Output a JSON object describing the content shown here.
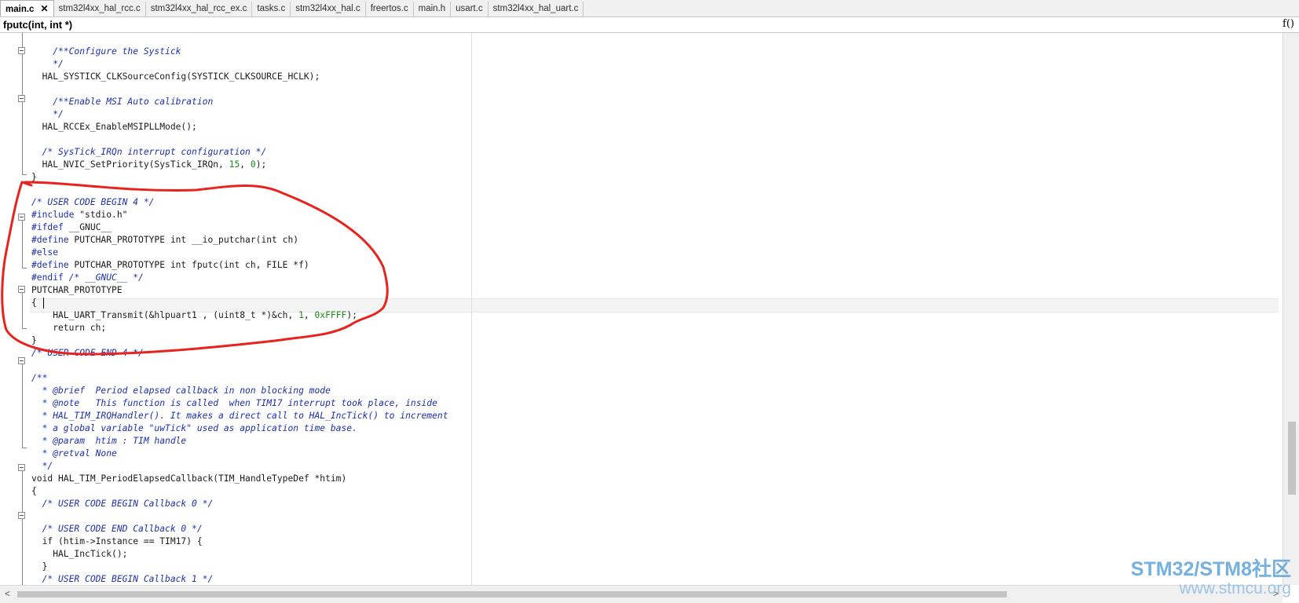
{
  "tabs": [
    {
      "label": "main.c",
      "active": true
    },
    {
      "label": "stm32l4xx_hal_rcc.c"
    },
    {
      "label": "stm32l4xx_hal_rcc_ex.c"
    },
    {
      "label": "tasks.c"
    },
    {
      "label": "stm32l4xx_hal.c"
    },
    {
      "label": "freertos.c"
    },
    {
      "label": "main.h"
    },
    {
      "label": "usart.c"
    },
    {
      "label": "stm32l4xx_hal_uart.c"
    }
  ],
  "tab_close_glyph": "✕",
  "function_bar": {
    "name": "fputc(int, int *)",
    "icon_label": "f()"
  },
  "code_lines": [
    "",
    "    /**Configure the Systick",
    "    */",
    "  HAL_SYSTICK_CLKSourceConfig(SYSTICK_CLKSOURCE_HCLK);",
    "",
    "    /**Enable MSI Auto calibration",
    "    */",
    "  HAL_RCCEx_EnableMSIPLLMode();",
    "",
    "  /* SysTick_IRQn interrupt configuration */",
    "  HAL_NVIC_SetPriority(SysTick_IRQn, 15, 0);",
    "}",
    "",
    "/* USER CODE BEGIN 4 */",
    "#include \"stdio.h\"",
    "#ifdef __GNUC__",
    "#define PUTCHAR_PROTOTYPE int __io_putchar(int ch)",
    "#else",
    "#define PUTCHAR_PROTOTYPE int fputc(int ch, FILE *f)",
    "#endif /* __GNUC__ */",
    "PUTCHAR_PROTOTYPE",
    "{",
    "    HAL_UART_Transmit(&hlpuart1 , (uint8_t *)&ch, 1, 0xFFFF);",
    "    return ch;",
    "}",
    "/* USER CODE END 4 */",
    "",
    "/**",
    "  * @brief  Period elapsed callback in non blocking mode",
    "  * @note   This function is called  when TIM17 interrupt took place, inside",
    "  * HAL_TIM_IRQHandler(). It makes a direct call to HAL_IncTick() to increment",
    "  * a global variable \"uwTick\" used as application time base.",
    "  * @param  htim : TIM handle",
    "  * @retval None",
    "  */",
    "void HAL_TIM_PeriodElapsedCallback(TIM_HandleTypeDef *htim)",
    "{",
    "  /* USER CODE BEGIN Callback 0 */",
    "",
    "  /* USER CODE END Callback 0 */",
    "  if (htim->Instance == TIM17) {",
    "    HAL_IncTick();",
    "  }",
    "  /* USER CODE BEGIN Callback 1 */"
  ],
  "scroll_arrows": {
    "left": "<",
    "right": ">"
  },
  "annotation_color": "#e8231e",
  "watermark": {
    "line1": "STM32/STM8社区",
    "line2": "www.stmcu.org"
  }
}
